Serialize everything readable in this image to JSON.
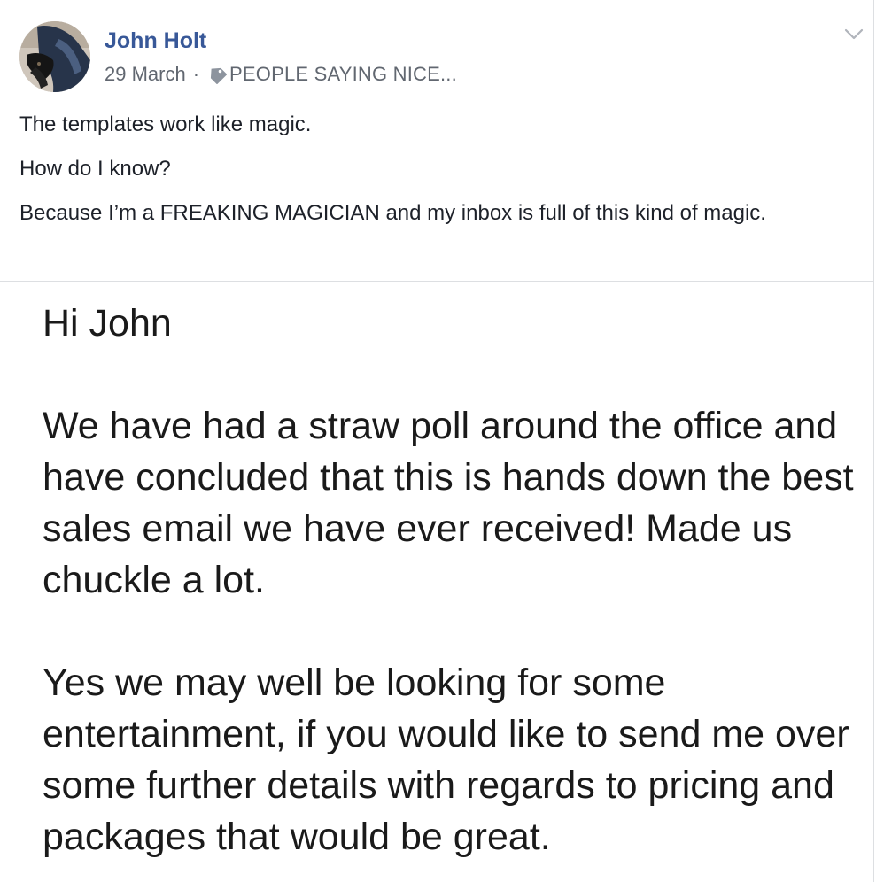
{
  "post": {
    "author": "John Holt",
    "date": "29 March",
    "separator": "·",
    "tag_icon": "tag-icon",
    "tag_label": "PEOPLE SAYING NICE...",
    "menu_icon": "chevron-down-icon",
    "paragraphs": [
      "The templates work like magic.",
      "How do I know?",
      "Because I’m a FREAKING MAGICIAN and my inbox is full of this kind of magic."
    ]
  },
  "email_image": {
    "greeting": "Hi John",
    "paragraph_1": "We have had a straw poll around the office and have concluded that this is hands down the best sales email we have ever received! Made us chuckle a lot.",
    "paragraph_2": "Yes we may well be looking for some entertainment, if you would like to send me over some further details with regards to pricing and packages that would be great."
  },
  "colors": {
    "author_link": "#385898",
    "meta_text": "#616770",
    "body_text": "#1d2129",
    "divider": "#dddfe2"
  }
}
